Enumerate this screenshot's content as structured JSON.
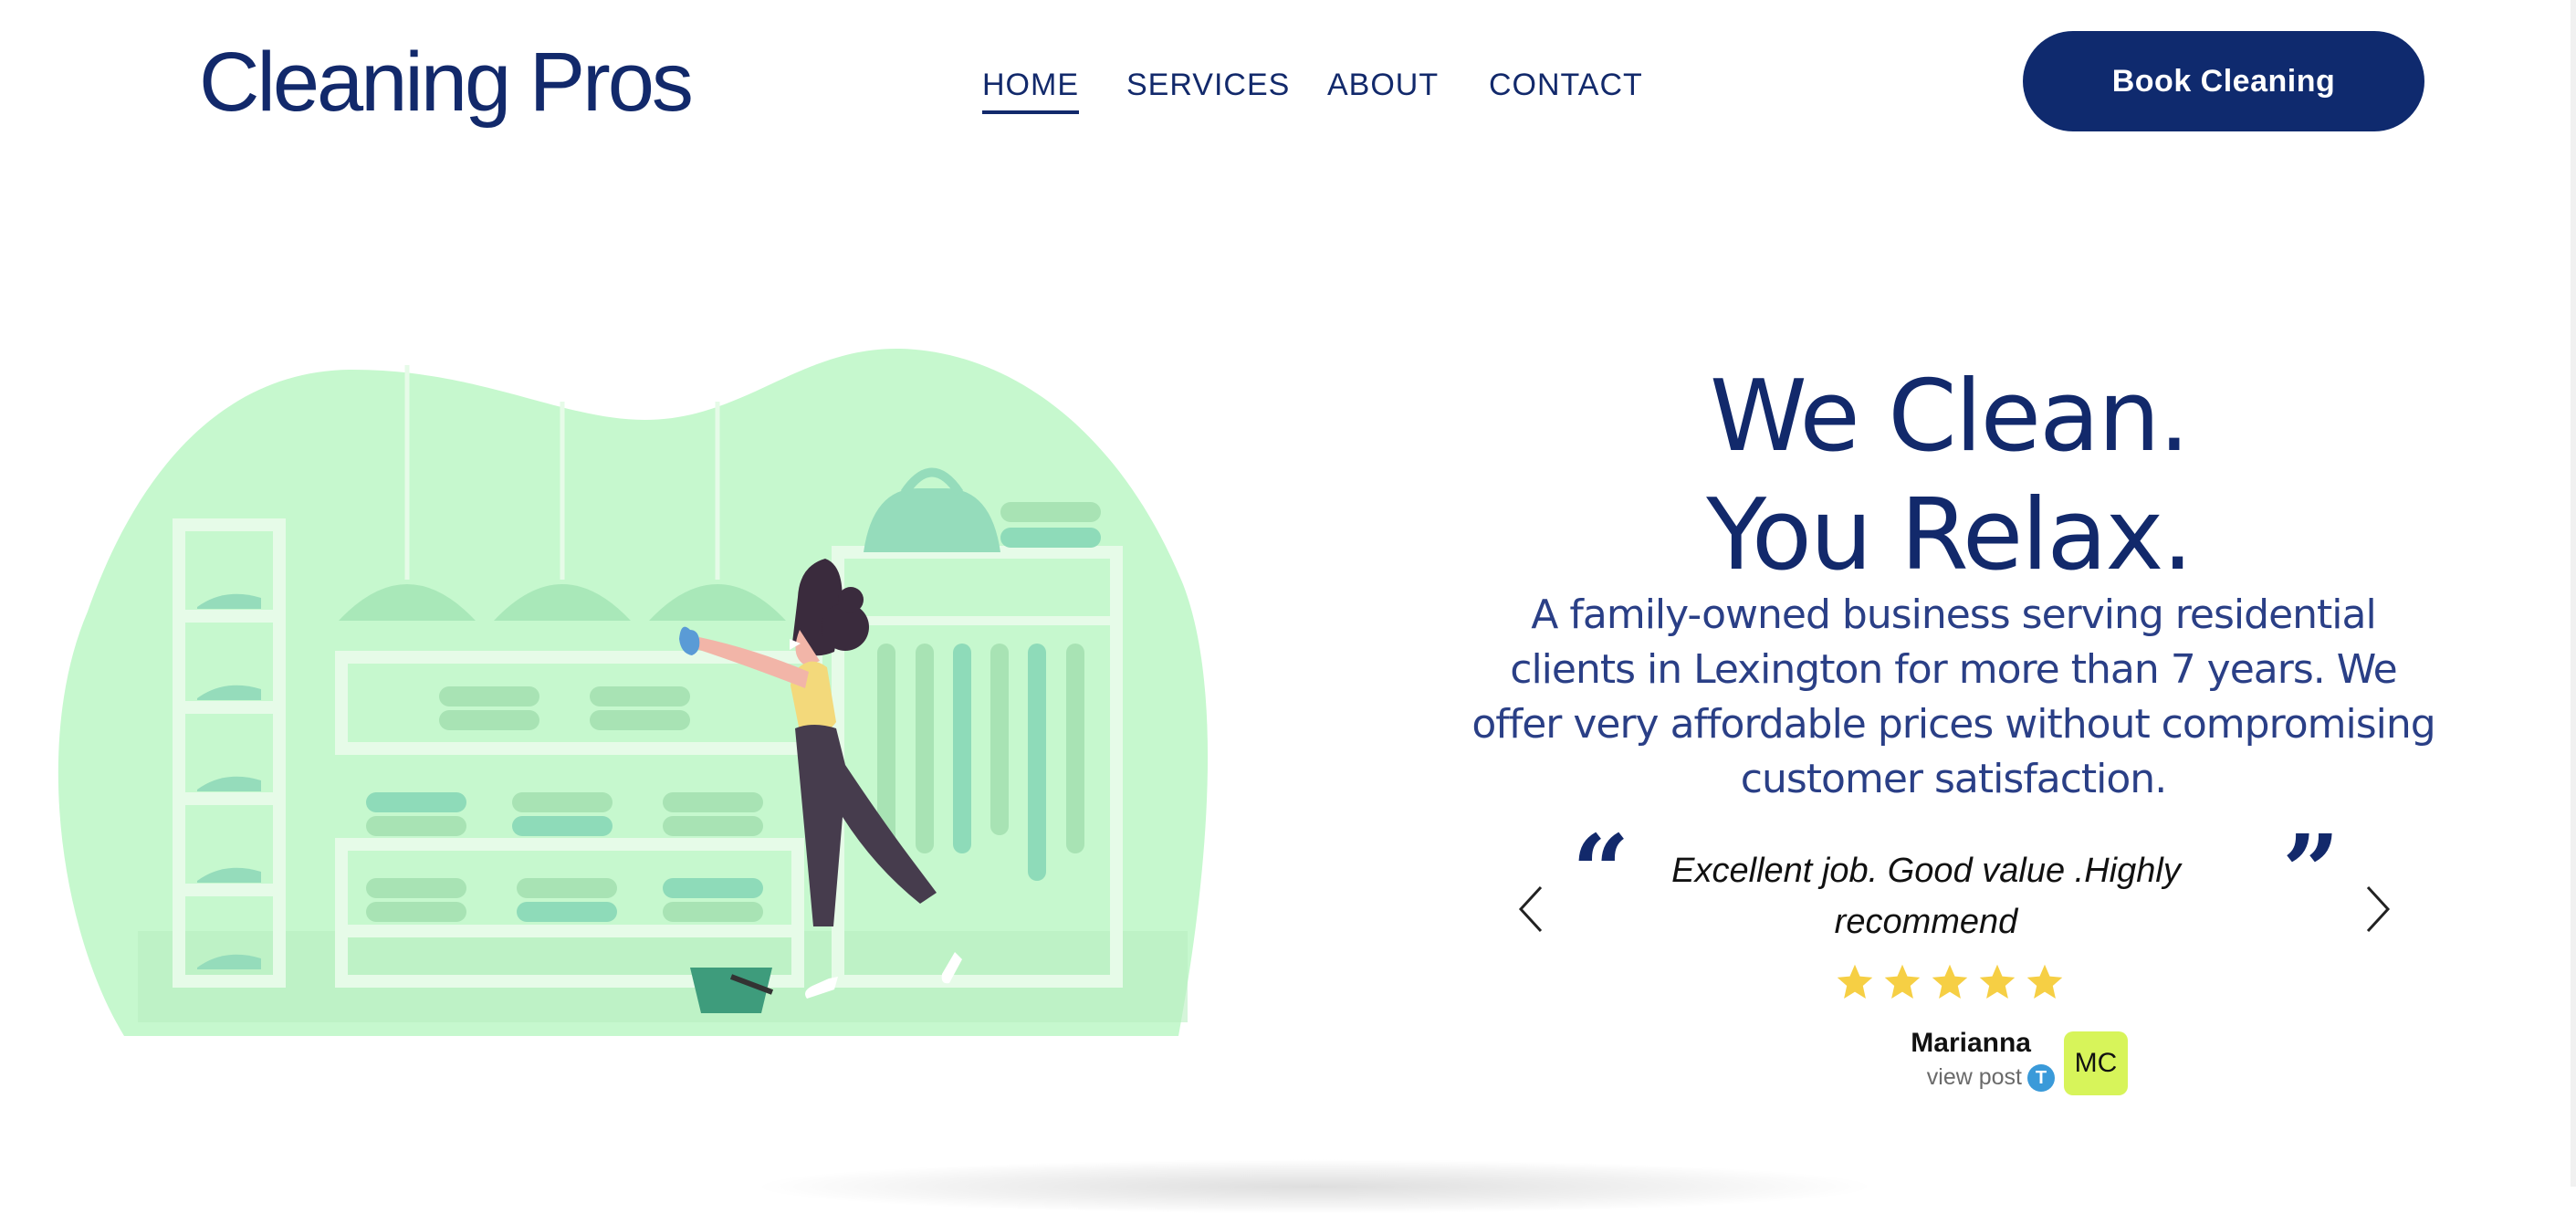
{
  "brand": {
    "logo": "Cleaning Pros"
  },
  "nav": {
    "items": [
      {
        "label": "HOME",
        "active": true
      },
      {
        "label": "SERVICES",
        "active": false
      },
      {
        "label": "ABOUT",
        "active": false
      },
      {
        "label": "CONTACT",
        "active": false
      }
    ]
  },
  "cta": {
    "book_label": "Book Cleaning"
  },
  "hero": {
    "headline_line1": "We Clean.",
    "headline_line2": "You Relax.",
    "subtext": "A family-owned business serving residential clients in Lexington for more than 7 years. We offer very affordable prices without compromising customer satisfaction."
  },
  "testimonial": {
    "quote_open": "“",
    "quote_close": "”",
    "text": "Excellent job. Good value .Highly recommend",
    "rating": 5,
    "reviewer_name": "Marianna",
    "view_post": "view post",
    "avatar_initials": "MC",
    "platform_icon_letter": "T"
  },
  "colors": {
    "brand_navy": "#12296b",
    "button_navy": "#0f2a6e",
    "illustration_green": "#c6f8ce",
    "star_yellow": "#f6cf44",
    "avatar_lime": "#d7f45a"
  }
}
